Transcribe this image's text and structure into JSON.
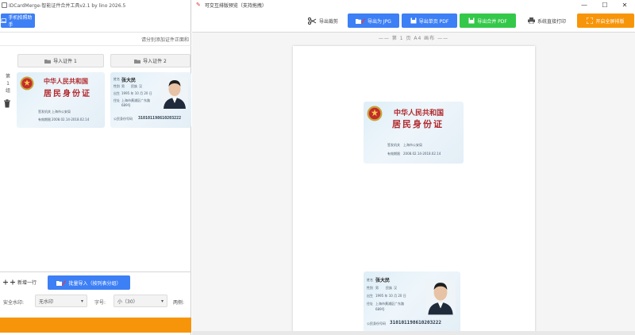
{
  "left_window": {
    "title": "IDCardMerge-智能证件合并工具v2.1 by lino 2026.5",
    "mobile_button": "手机拍照助手",
    "hint": "请分别添加证件正面和",
    "import_front": "导入证件 1",
    "import_back": "导入证件 2",
    "row_label": "第 1 组",
    "add_row": "新增一行",
    "batch_import": "批量导入（按列表分组）",
    "watermark_label": "安全水印:",
    "watermark_value": "无水印",
    "font_label": "字号:",
    "font_value": "小（30）",
    "opacity_label": "两侧:"
  },
  "id_card_front": {
    "country": "中华人民共和国",
    "title": "居民身份证",
    "authority_label": "签发机关",
    "authority": "上海市公安局",
    "validity_label": "有效期限",
    "validity": "2008.02.14-2018.02.14"
  },
  "id_card_back": {
    "name_label": "姓名",
    "name": "张大民",
    "sex_label": "性别",
    "sex": "男",
    "nation_label": "民族",
    "nation": "汉",
    "birth_label": "出生",
    "birth": "1995 年 10 月 20 日",
    "address_label": "住址",
    "address_1": "上海市黄浦区广东路",
    "address_2": "689号",
    "id_label": "公民身份号码",
    "id_number": "310101198610203222"
  },
  "right_window": {
    "title": "可交互排版预览（支持拖拽）",
    "buttons": {
      "crop": "导出裁剪",
      "export_jpg": "导出为 JPG",
      "export_pdf": "导出单页 PDF",
      "export_merge_pdf": "导出合并 PDF",
      "print": "系统直接打印",
      "fullscreen": "开启全屏排版"
    },
    "page_label": "—— 第 1 页 A4 画布 ——"
  },
  "colors": {
    "primary_blue": "#3d7ff5",
    "green": "#34c84a",
    "orange": "#f7950a",
    "card_red": "#b0282c"
  }
}
